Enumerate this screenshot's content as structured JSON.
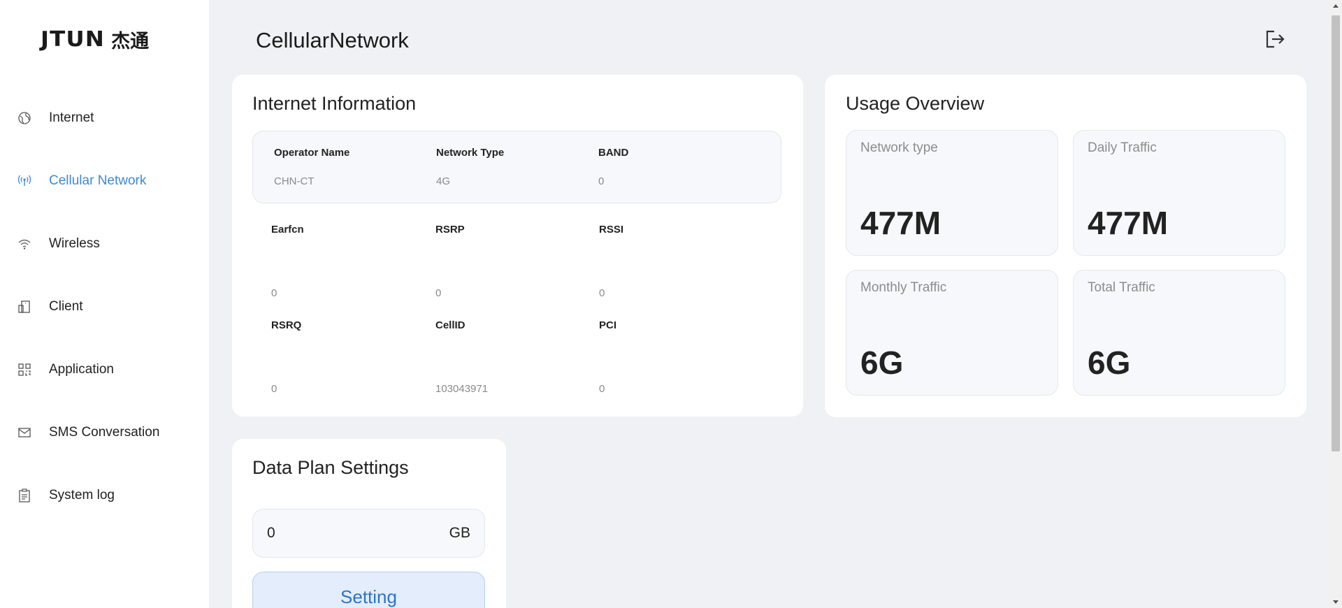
{
  "brand": {
    "latin": "JTUN",
    "cjk": "杰通"
  },
  "sidebar": {
    "items": [
      {
        "label": "Internet",
        "icon": "globe-icon",
        "active": false
      },
      {
        "label": "Cellular Network",
        "icon": "antenna-icon",
        "active": true
      },
      {
        "label": "Wireless",
        "icon": "wifi-icon",
        "active": false
      },
      {
        "label": "Client",
        "icon": "client-device-icon",
        "active": false
      },
      {
        "label": "Application",
        "icon": "apps-grid-icon",
        "active": false
      },
      {
        "label": "SMS Conversation",
        "icon": "mail-icon",
        "active": false
      },
      {
        "label": "System log",
        "icon": "clipboard-icon",
        "active": false
      }
    ],
    "active_color": "#3b8bd4"
  },
  "header": {
    "title": "CellularNetwork",
    "logout_icon": "logout-icon"
  },
  "internet_info": {
    "title": "Internet Information",
    "operator_label": "Operator Name",
    "operator_value": "CHN-CT",
    "network_type_label": "Network Type",
    "network_type_value": "4G",
    "band_label": "BAND",
    "band_value": "0",
    "earfcn_label": "Earfcn",
    "earfcn_value": "0",
    "rsrp_label": "RSRP",
    "rsrp_value": "0",
    "rssi_label": "RSSI",
    "rssi_value": "0",
    "rsrq_label": "RSRQ",
    "rsrq_value": "0",
    "cellid_label": "CellID",
    "cellid_value": "103043971",
    "pci_label": "PCI",
    "pci_value": "0"
  },
  "usage": {
    "title": "Usage Overview",
    "network_type_label": "Network type",
    "network_type_value": "477M",
    "daily_label": "Daily Traffic",
    "daily_value": "477M",
    "monthly_label": "Monthly Traffic",
    "monthly_value": "6G",
    "total_label": "Total Traffic",
    "total_value": "6G"
  },
  "data_plan": {
    "title": "Data Plan Settings",
    "value": "0",
    "unit": "GB",
    "button_label": "Setting"
  }
}
